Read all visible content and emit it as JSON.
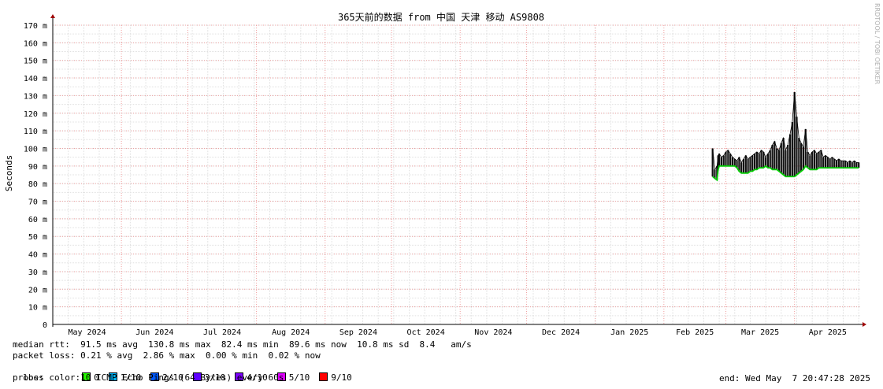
{
  "chart_data": {
    "type": "line",
    "title": "365天前的数据 from 中国 天津 移动 AS9808",
    "ylabel": "Seconds",
    "xlabel": "",
    "y_unit_suffix": "m",
    "ylim": [
      0,
      170
    ],
    "yticks": [
      0,
      10,
      20,
      30,
      40,
      50,
      60,
      70,
      80,
      90,
      100,
      110,
      120,
      130,
      140,
      150,
      160,
      170
    ],
    "yticklabels": [
      "0",
      "10 m",
      "20 m",
      "30 m",
      "40 m",
      "50 m",
      "60 m",
      "70 m",
      "80 m",
      "90 m",
      "100 m",
      "110 m",
      "120 m",
      "130 m",
      "140 m",
      "150 m",
      "160 m",
      "170 m"
    ],
    "x_range_days": [
      0,
      365
    ],
    "month_boundaries_day": [
      0,
      31,
      61,
      92,
      123,
      153,
      184,
      214,
      245,
      276,
      304,
      335
    ],
    "xticklabels": [
      "May 2024",
      "Jun 2024",
      "Jul 2024",
      "Aug 2024",
      "Sep 2024",
      "Oct 2024",
      "Nov 2024",
      "Dec 2024",
      "Jan 2025",
      "Feb 2025",
      "Mar 2025",
      "Apr 2025"
    ],
    "grid": true,
    "series": [
      {
        "name": "median rtt",
        "color": "#00cc00",
        "x_day": [
          298,
          299,
          300,
          300.5,
          301,
          302,
          303,
          304,
          305,
          306,
          307,
          308,
          309,
          310,
          311,
          312,
          313,
          314,
          315,
          316,
          317,
          318,
          319,
          320,
          321,
          322,
          323,
          324,
          325,
          326,
          327,
          328,
          329,
          330,
          331,
          332,
          333,
          334,
          335,
          336,
          337,
          338,
          339,
          340,
          341,
          342,
          343,
          344,
          345,
          346,
          347,
          348,
          349,
          350,
          351,
          352,
          353,
          354,
          355,
          356,
          357,
          358,
          359,
          360,
          361,
          362,
          363,
          364
        ],
        "y": [
          84,
          83,
          82,
          88,
          90,
          90,
          90,
          90,
          90,
          90,
          90,
          90,
          89,
          87,
          86,
          86,
          86,
          86,
          87,
          87,
          88,
          88,
          89,
          89,
          89,
          90,
          89,
          89,
          88,
          88,
          88,
          87,
          86,
          85,
          84,
          84,
          84,
          84,
          84,
          85,
          86,
          87,
          88,
          90,
          89,
          88,
          88,
          88,
          88,
          89,
          89,
          89,
          89,
          89,
          89,
          89,
          89,
          89,
          89,
          89,
          89,
          89,
          89,
          89,
          89,
          89,
          89,
          89
        ]
      },
      {
        "name": "max",
        "color": "#000000",
        "x_day": [
          298,
          299,
          300,
          300.5,
          301,
          302,
          303,
          304,
          305,
          306,
          307,
          308,
          309,
          310,
          311,
          312,
          313,
          314,
          315,
          316,
          317,
          318,
          319,
          320,
          321,
          322,
          323,
          324,
          325,
          326,
          327,
          328,
          329,
          330,
          331,
          332,
          333,
          334,
          335,
          336,
          337,
          338,
          339,
          340,
          341,
          342,
          343,
          344,
          345,
          346,
          347,
          348,
          349,
          350,
          351,
          352,
          353,
          354,
          355,
          356,
          357,
          358,
          359,
          360,
          361,
          362,
          363,
          364
        ],
        "y": [
          100,
          88,
          90,
          96,
          97,
          95,
          96,
          98,
          99,
          97,
          95,
          94,
          93,
          95,
          92,
          94,
          96,
          94,
          95,
          96,
          97,
          98,
          97,
          99,
          98,
          95,
          97,
          99,
          102,
          104,
          100,
          99,
          103,
          106,
          99,
          102,
          108,
          115,
          132,
          118,
          106,
          103,
          101,
          111,
          98,
          96,
          98,
          99,
          97,
          98,
          99,
          95,
          96,
          95,
          94,
          95,
          94,
          93,
          94,
          93,
          93,
          93,
          92,
          93,
          92,
          93,
          92,
          92
        ]
      }
    ]
  },
  "stats": {
    "median_rtt_line": "median rtt:  91.5 ms avg  130.8 ms max  82.4 ms min  89.6 ms now  10.8 ms sd  8.4   am/s",
    "packet_loss_line": "packet loss: 0.21 % avg  2.86 % max  0.00 % min  0.02 % now",
    "loss_color_label": "loss color:",
    "loss_legend": [
      {
        "label": "0",
        "color": "#26ff00"
      },
      {
        "label": "1/10",
        "color": "#00b8ff"
      },
      {
        "label": "2/10",
        "color": "#0059ff"
      },
      {
        "label": "3/10",
        "color": "#5e00ff"
      },
      {
        "label": "4/10",
        "color": "#7e00ff"
      },
      {
        "label": "5/10",
        "color": "#dd00ff"
      },
      {
        "label": "9/10",
        "color": "#ff0000"
      }
    ],
    "probe_line": "probe:       10 ICMP Echo Pings (64 Bytes) every 60s",
    "end_line": "end: Wed May  7 20:47:28 2025"
  },
  "watermark": "RRDTOOL / TOBI OETIKER"
}
